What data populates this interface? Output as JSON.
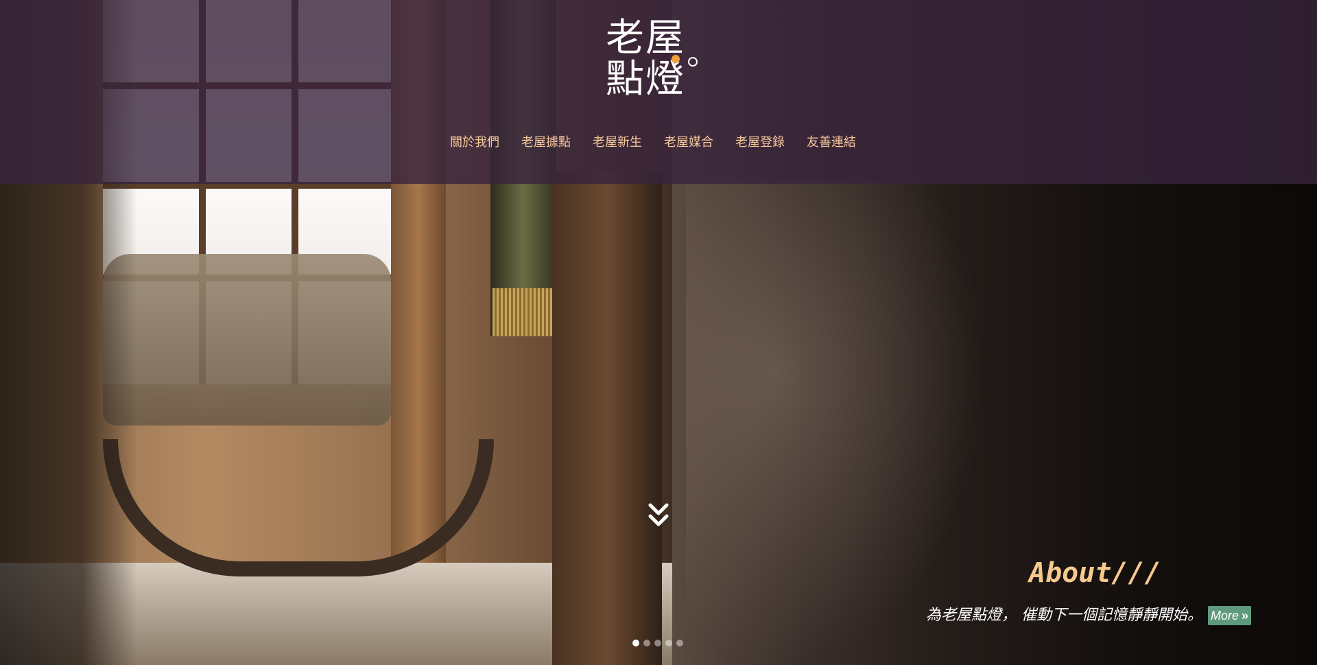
{
  "site": {
    "logo_line1": "老屋",
    "logo_line2": "點燈"
  },
  "nav": {
    "items": [
      {
        "label": "關於我們"
      },
      {
        "label": "老屋據點"
      },
      {
        "label": "老屋新生"
      },
      {
        "label": "老屋媒合"
      },
      {
        "label": "老屋登錄"
      },
      {
        "label": "友善連結"
      }
    ]
  },
  "hero": {
    "scroll_icon": "double-chevron-down-icon",
    "about_title": "About///",
    "about_text": "為老屋點燈， 催動下一個記憶靜靜開始。",
    "more_label": "More",
    "more_icon": "double-chevron-right-icon",
    "slider": {
      "count": 5,
      "active": 1
    }
  },
  "colors": {
    "header_overlay": "#38243c",
    "nav_text": "#f4c79a",
    "about_title": "#f6c98e",
    "more_button": "#5f9a7c",
    "logo_accent": "#f2a23a"
  }
}
